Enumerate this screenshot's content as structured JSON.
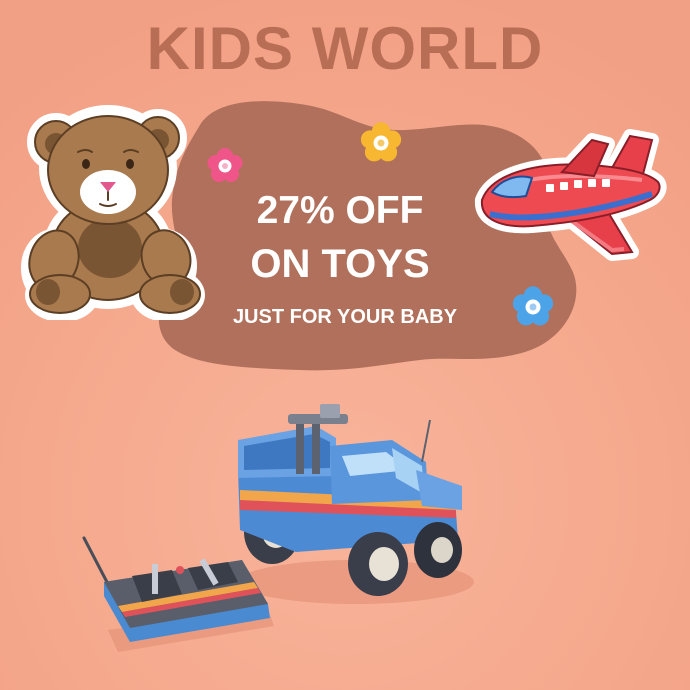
{
  "brand": {
    "title": "KIDS WORLD"
  },
  "promo": {
    "line1": "27% OFF",
    "line2": "ON TOYS",
    "tagline": "JUST FOR YOUR BABY"
  },
  "colors": {
    "background": "#F6A88C",
    "title": "#B86E55",
    "blob": "#B0705C",
    "text": "#FFFFFF"
  },
  "icons": {
    "teddy": "teddy-bear-icon",
    "plane": "toy-airplane-icon",
    "truck": "toy-truck-icon",
    "remote": "remote-control-icon",
    "flower_pink": "flower-icon",
    "flower_yellow": "flower-icon",
    "flower_blue": "flower-icon"
  }
}
